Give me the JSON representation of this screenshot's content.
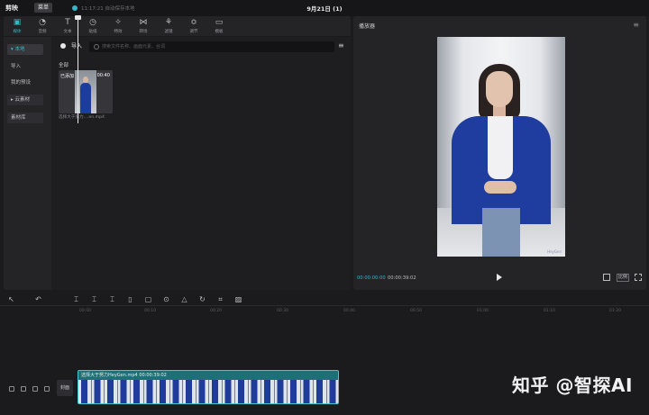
{
  "app": {
    "logo": "剪映",
    "menu_label": "菜单",
    "save_status": "11:17:21 自动保存本地",
    "doc_title": "9月21日 (1)"
  },
  "tool_tabs": [
    {
      "label": "媒体",
      "icon": "media-icon",
      "active": true
    },
    {
      "label": "音频",
      "icon": "audio-icon"
    },
    {
      "label": "文本",
      "icon": "text-icon"
    },
    {
      "label": "贴纸",
      "icon": "sticker-icon"
    },
    {
      "label": "特效",
      "icon": "effects-icon"
    },
    {
      "label": "转场",
      "icon": "transition-icon"
    },
    {
      "label": "滤镜",
      "icon": "filter-icon"
    },
    {
      "label": "调节",
      "icon": "adjust-icon"
    },
    {
      "label": "模板",
      "icon": "template-icon"
    }
  ],
  "side_nav": [
    {
      "label": "▾ 本地",
      "active": true
    },
    {
      "label": "导入"
    },
    {
      "label": "我的预设"
    },
    {
      "label": "▸ 云素材"
    },
    {
      "label": "素材库"
    }
  ],
  "media": {
    "import_label": "导入",
    "search_placeholder": "搜索文件名称、画面元素、台词",
    "section_label": "全部",
    "item": {
      "tag": "已添加",
      "duration": "00:40",
      "name": "选择大于努力....en.mp4"
    }
  },
  "player": {
    "title": "播放器",
    "current_time": "00:00:00:00",
    "total_time": "00:00:39:02",
    "ratio_label": "比例",
    "watermark": "HeyGen"
  },
  "timeline": {
    "ticks": [
      "00:00",
      "00:10",
      "00:20",
      "00:30",
      "00:40",
      "00:50",
      "01:00",
      "01:10",
      "01:20"
    ],
    "clip_label": "选择大于努力HeyGen.mp4   00:00:39:02",
    "cover_label": "封面"
  },
  "overlay_watermark": "知乎 @智探AI",
  "colors": {
    "accent": "#35b6c4",
    "panel": "#242427",
    "clip": "#1e6f78"
  }
}
